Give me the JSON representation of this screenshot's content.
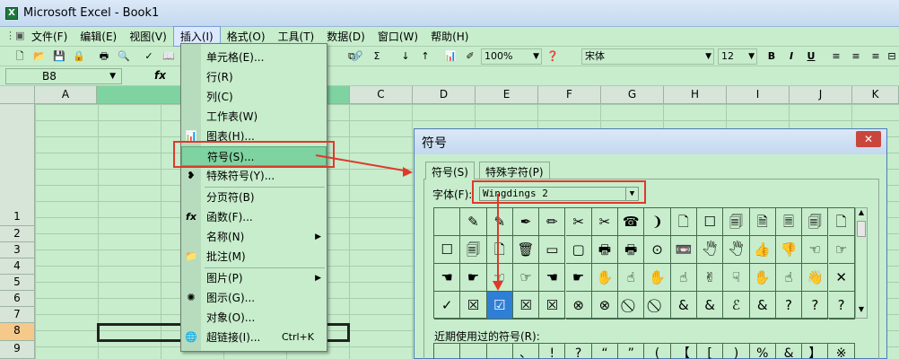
{
  "window": {
    "title": "Microsoft Excel - Book1"
  },
  "menubar": [
    "文件(F)",
    "编辑(E)",
    "视图(V)",
    "插入(I)",
    "格式(O)",
    "工具(T)",
    "数据(D)",
    "窗口(W)",
    "帮助(H)"
  ],
  "toolbar": {
    "zoom": "100%",
    "font": "宋体",
    "size": "12",
    "bold": "B",
    "italic": "I",
    "underline": "U"
  },
  "formula_bar": {
    "cell_ref": "B8",
    "fx": "fx"
  },
  "columns": [
    "A",
    "B",
    "C",
    "D",
    "E",
    "F",
    "G",
    "H",
    "I",
    "J",
    "K"
  ],
  "rows": [
    "1",
    "2",
    "3",
    "4",
    "5",
    "6",
    "7",
    "8",
    "9"
  ],
  "insert_menu": {
    "items": [
      {
        "label": "单元格(E)...",
        "icon": ""
      },
      {
        "label": "行(R)",
        "icon": ""
      },
      {
        "label": "列(C)",
        "icon": ""
      },
      {
        "label": "工作表(W)",
        "icon": ""
      },
      {
        "label": "图表(H)...",
        "icon": "chart-icon"
      },
      {
        "label": "符号(S)...",
        "icon": ""
      },
      {
        "label": "特殊符号(Y)...",
        "icon": "bullet-icon"
      },
      {
        "label": "分页符(B)",
        "icon": ""
      },
      {
        "label": "函数(F)...",
        "icon": "fx-icon"
      },
      {
        "label": "名称(N)",
        "icon": ""
      },
      {
        "label": "批注(M)",
        "icon": "comment-icon"
      },
      {
        "label": "图片(P)",
        "icon": ""
      },
      {
        "label": "图示(G)...",
        "icon": "diagram-icon"
      },
      {
        "label": "对象(O)...",
        "icon": ""
      },
      {
        "label": "超链接(I)...",
        "icon": "hyperlink-icon",
        "shortcut": "Ctrl+K"
      }
    ]
  },
  "symbol_dialog": {
    "title": "符号",
    "close": "✕",
    "tabs": [
      "符号(S)",
      "特殊字符(P)"
    ],
    "font_label": "字体(F):",
    "font_value": "Wingdings 2",
    "recent_label": "近期使用过的符号(R):",
    "symbols": [
      [
        "",
        "✎",
        "✎",
        "✒",
        "✏",
        "✂",
        "✂",
        "☎",
        "❩",
        "🗋",
        "☐",
        "🗐",
        "🗎",
        "🗏",
        "🗐",
        "🗋"
      ],
      [
        "☐",
        "🗐",
        "🗋",
        "🗑",
        "▭",
        "▢",
        "🖶",
        "🖶",
        "⊙",
        "📼",
        "🖑",
        "🖑",
        "👍",
        "👎",
        "☜",
        "☞"
      ],
      [
        "☚",
        "☛",
        "☜",
        "☞",
        "☚",
        "☛",
        "✋",
        "☝",
        "✋",
        "☝",
        "✌",
        "☟",
        "✋",
        "☝",
        "👋",
        "✕"
      ],
      [
        "✓",
        "☒",
        "☑",
        "☒",
        "☒",
        "⊗",
        "⊗",
        "⃠",
        "⃠",
        "&",
        "&",
        "ℰ",
        "&",
        "?",
        "?",
        "?"
      ]
    ],
    "recent": [
      "",
      "",
      "",
      "、",
      "!",
      "?",
      "“",
      "”",
      "(",
      "【",
      "[",
      ")",
      "%",
      "&",
      "】",
      "※"
    ]
  }
}
